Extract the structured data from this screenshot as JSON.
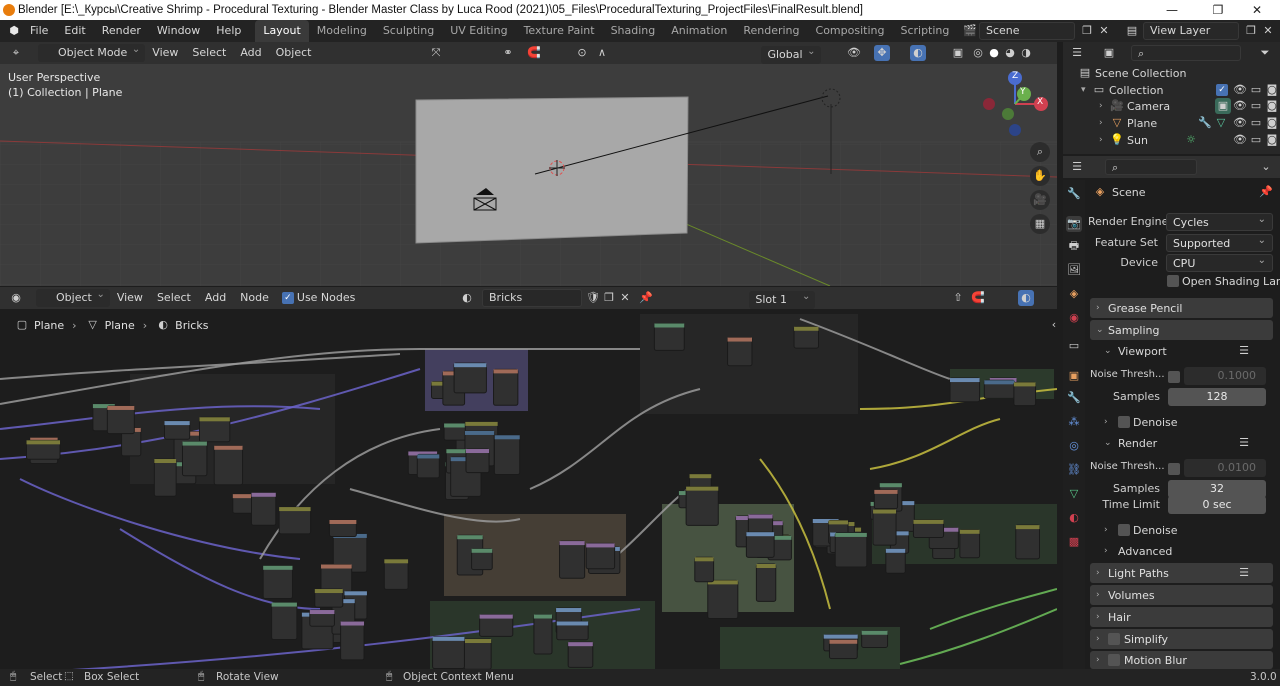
{
  "window": {
    "title": "Blender [E:\\_Курсы\\Creative Shrimp - Procedural Texturing - Blender Master Class by Luca Rood (2021)\\05_Files\\ProceduralTexturing_ProjectFiles\\FinalResult.blend]",
    "minimize": "—",
    "maximize": "❐",
    "close": "✕"
  },
  "menu": [
    "File",
    "Edit",
    "Render",
    "Window",
    "Help"
  ],
  "workspaces": [
    "Layout",
    "Modeling",
    "Sculpting",
    "UV Editing",
    "Texture Paint",
    "Shading",
    "Animation",
    "Rendering",
    "Compositing",
    "Scripting"
  ],
  "active_workspace": "Layout",
  "add_workspace": "+",
  "scene": {
    "name": "Scene",
    "view_layer": "View Layer"
  },
  "viewport": {
    "mode": "Object Mode",
    "menus": [
      "View",
      "Select",
      "Add",
      "Object"
    ],
    "transform_orientation": "Global",
    "overlay_line1": "User Perspective",
    "overlay_line2": "(1) Collection | Plane",
    "gizmo": {
      "z": "Z",
      "y": "Y",
      "x": "X"
    }
  },
  "node_editor": {
    "editor_type": "Object",
    "menus": [
      "View",
      "Select",
      "Add",
      "Node"
    ],
    "use_nodes_label": "Use Nodes",
    "use_nodes": true,
    "slot": "Slot 1",
    "material": "Bricks",
    "breadcrumb": [
      "Plane",
      "Plane",
      "Bricks"
    ]
  },
  "outliner": {
    "root": "Scene Collection",
    "collection": "Collection",
    "items": [
      {
        "name": "Camera",
        "color": "#9ab4c8"
      },
      {
        "name": "Plane",
        "color": "#e8a060"
      },
      {
        "name": "Sun",
        "color": "#e8a060"
      }
    ]
  },
  "properties": {
    "header": "Scene",
    "render_engine_label": "Render Engine",
    "render_engine": "Cycles",
    "feature_set_label": "Feature Set",
    "feature_set": "Supported",
    "device_label": "Device",
    "device": "CPU",
    "osl_label": "Open Shading Lang...",
    "panels": {
      "grease_pencil": "Grease Pencil",
      "sampling": "Sampling",
      "viewport": "Viewport",
      "noise_threshold_label": "Noise Thresh...",
      "viewport_noise_threshold": "0.1000",
      "samples_label": "Samples",
      "viewport_samples": "128",
      "denoise": "Denoise",
      "render": "Render",
      "render_noise_threshold": "0.0100",
      "render_samples": "32",
      "time_limit_label": "Time Limit",
      "time_limit": "0 sec",
      "advanced": "Advanced",
      "light_paths": "Light Paths",
      "volumes": "Volumes",
      "hair": "Hair",
      "simplify": "Simplify",
      "motion_blur": "Motion Blur"
    }
  },
  "statusbar": {
    "select": "Select",
    "box_select": "Box Select",
    "rotate_view": "Rotate View",
    "context_menu": "Object Context Menu",
    "version": "3.0.0"
  },
  "colors": {
    "accent": "#4772b3",
    "header": "#303030",
    "panel": "#3b3b3b",
    "node_bg": "#303030",
    "wire_shader": "#9a9a9a",
    "wire_vector": "#6b63c9",
    "wire_color": "#c8c040",
    "wire_float": "#6fc25c"
  }
}
